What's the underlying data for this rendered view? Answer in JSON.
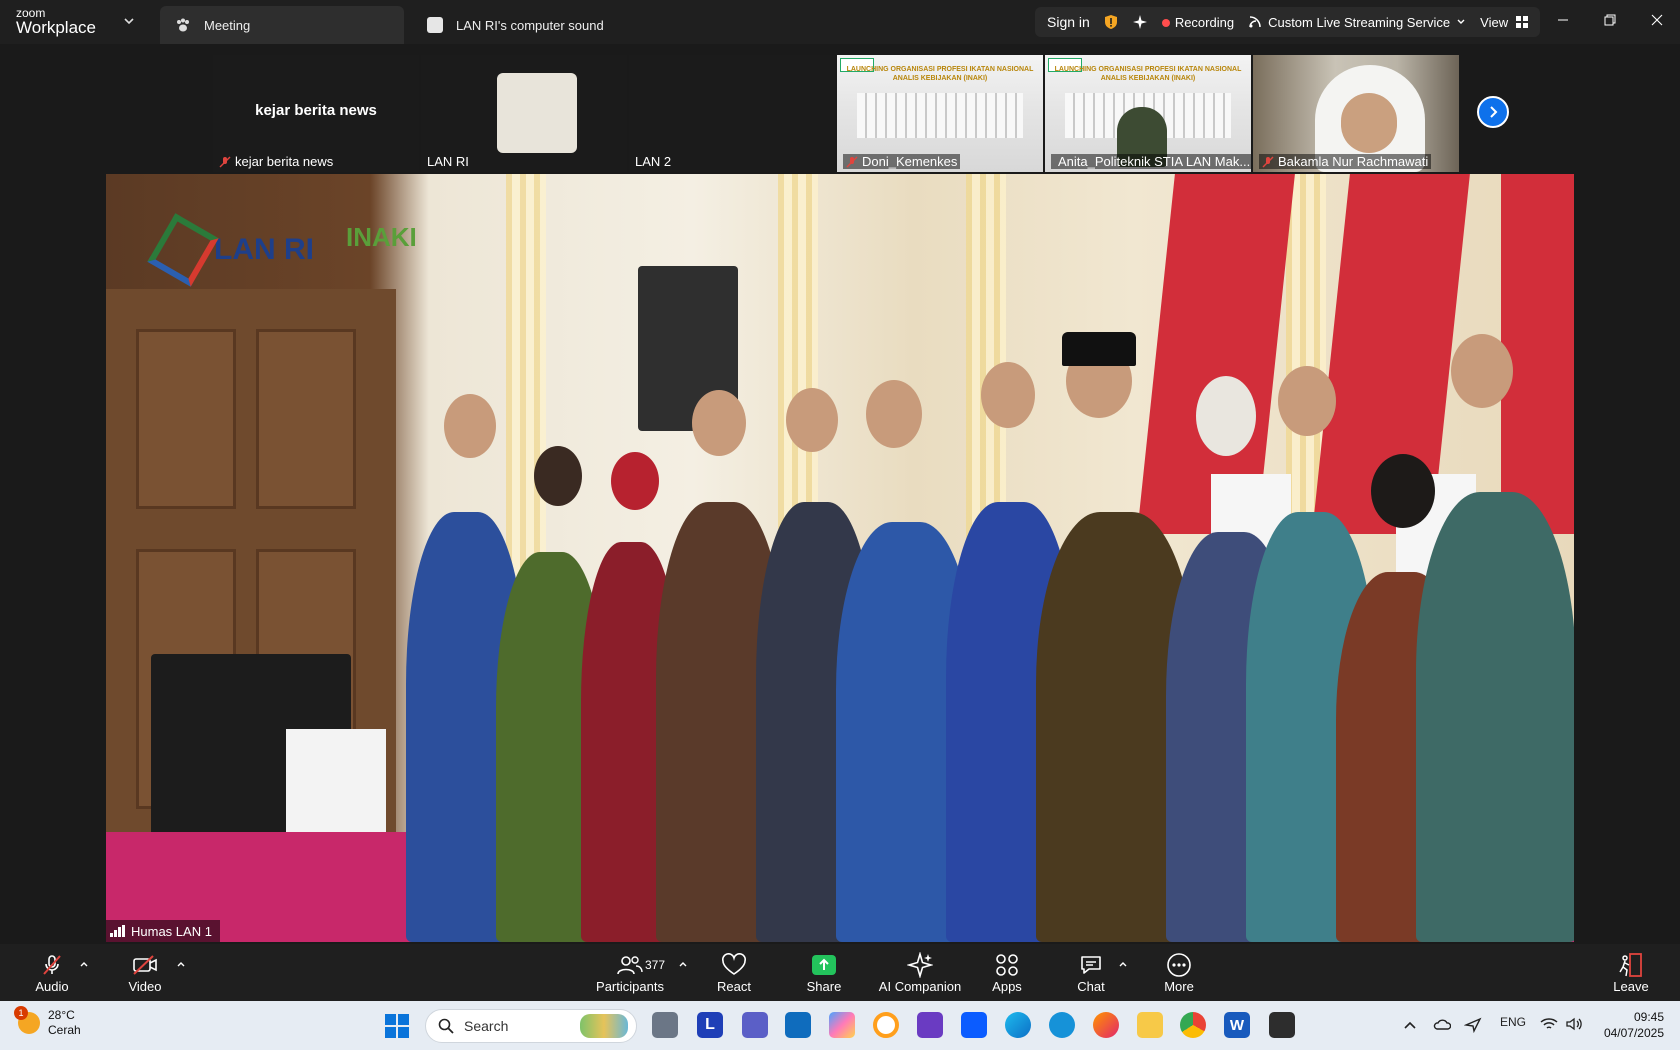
{
  "titlebar": {
    "brand_small": "zoom",
    "brand_large": "Workplace",
    "tabs": [
      {
        "label": "Meeting",
        "icon": "paw-meeting-icon",
        "active": true
      },
      {
        "label": "LAN RI's computer sound",
        "icon": "audio-source-icon",
        "active": false
      }
    ],
    "sign_in": "Sign in",
    "recording": "Recording",
    "streaming": "Custom Live Streaming Service",
    "view": "View"
  },
  "thumbnails": [
    {
      "name": "kejar berita news",
      "center_text": "kejar berita news",
      "muted": true
    },
    {
      "name": "LAN RI",
      "muted": false
    },
    {
      "name": "LAN 2",
      "muted": false
    },
    {
      "name": "Doni_Kemenkes",
      "muted": true,
      "slide_title": "LAUNCHING ORGANISASI PROFESI IKATAN NASIONAL ANALIS KEBIJAKAN (INAKI)"
    },
    {
      "name": "Anita_Politeknik STIA LAN Mak...",
      "muted": true,
      "slide_title": "LAUNCHING ORGANISASI PROFESI IKATAN NASIONAL ANALIS KEBIJAKAN (INAKI)"
    },
    {
      "name": "Bakamla Nur Rachmawati",
      "muted": true
    }
  ],
  "main_video": {
    "speaker_label": "Humas LAN 1",
    "logo_text": "LAN RI",
    "logo_secondary": "INAKI"
  },
  "controls": {
    "audio": "Audio",
    "video": "Video",
    "participants": "Participants",
    "participant_count": "377",
    "react": "React",
    "share": "Share",
    "ai_companion": "AI Companion",
    "apps": "Apps",
    "chat": "Chat",
    "more": "More",
    "leave": "Leave"
  },
  "taskbar": {
    "temperature": "28°C",
    "weather": "Cerah",
    "weather_badge": "1",
    "search_placeholder": "Search",
    "language": "ENG",
    "time": "09:45",
    "date": "04/07/2025"
  },
  "colors": {
    "accent_blue": "#0e71eb",
    "share_green": "#23c35c",
    "recording_red": "#ff4d4d",
    "muted_red": "#e0443e"
  }
}
